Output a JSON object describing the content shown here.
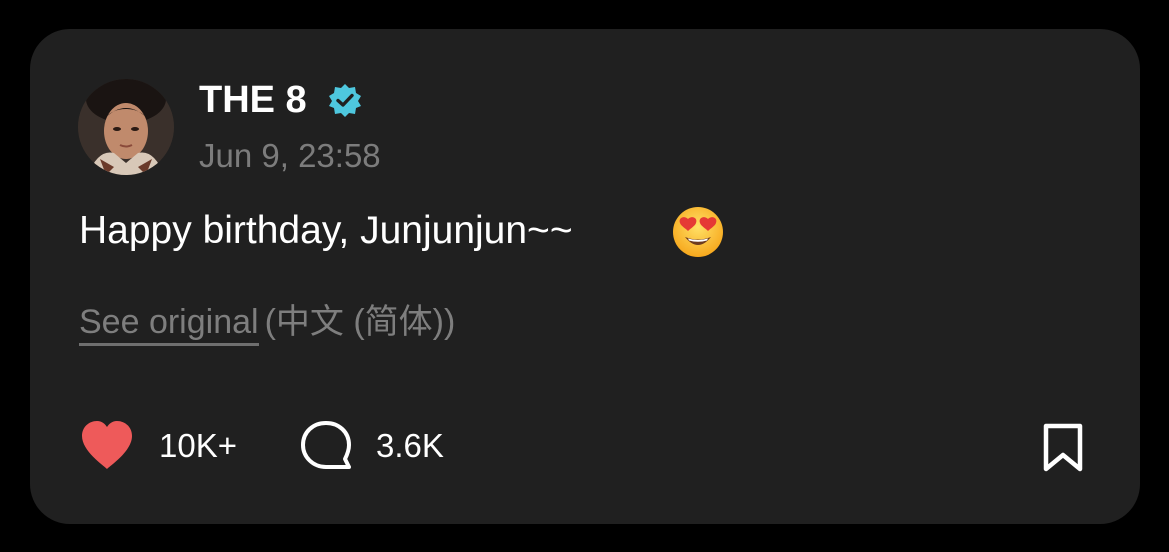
{
  "post": {
    "author": {
      "name": "THE 8",
      "verified_icon": "verified-badge-icon",
      "avatar_icon": "avatar-photo"
    },
    "timestamp": "Jun 9, 23:58",
    "text": "Happy birthday, Junjunjun~~",
    "emoji_icon": "smiling-face-with-heart-eyes-icon",
    "translation": {
      "see_original_label": "See original",
      "language_note": "(中文 (简体))"
    },
    "actions": {
      "like_icon": "heart-icon",
      "like_count": "10K+",
      "comment_icon": "speech-bubble-icon",
      "comment_count": "3.6K",
      "bookmark_icon": "bookmark-icon"
    }
  },
  "colors": {
    "background": "#000000",
    "card": "#202020",
    "text_primary": "#ffffff",
    "text_secondary": "#7c7c7c",
    "like_red": "#ee5a5a",
    "verified_teal": "#4ec7de"
  }
}
